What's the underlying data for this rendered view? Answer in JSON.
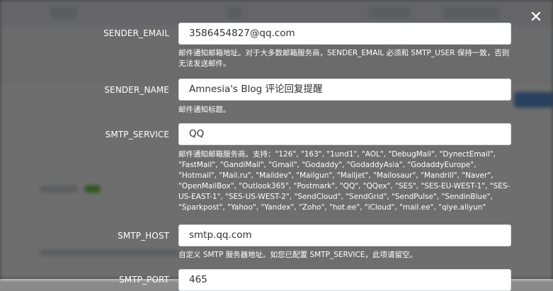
{
  "dialog": {
    "close_label": "✕"
  },
  "fields": [
    {
      "label": "SENDER_EMAIL",
      "value": "3586454827@qq.com",
      "help": "邮件通知邮箱地址。对于大多数邮箱服务商，SENDER_EMAIL 必须和 SMTP_USER 保持一致，否则无法发送邮件。"
    },
    {
      "label": "SENDER_NAME",
      "value": "Amnesia's Blog 评论回复提醒",
      "help": "邮件通知标题。"
    },
    {
      "label": "SMTP_SERVICE",
      "value": "QQ",
      "help": "邮件通知邮箱服务商。支持：\"126\", \"163\", \"1und1\", \"AOL\", \"DebugMail\", \"DynectEmail\", \"FastMail\", \"GandiMail\", \"Gmail\", \"Godaddy\", \"GodaddyAsia\", \"GodaddyEurope\", \"Hotmail\", \"Mail.ru\", \"Maildev\", \"Mailgun\", \"Mailjet\", \"Mailosaur\", \"Mandrill\", \"Naver\", \"OpenMailBox\", \"Outlook365\", \"Postmark\", \"QQ\", \"QQex\", \"SES\", \"SES-EU-WEST-1\", \"SES-US-EAST-1\", \"SES-US-WEST-2\", \"SendCloud\", \"SendGrid\", \"SendPulse\", \"SendinBlue\", \"Sparkpost\", \"Yahoo\", \"Yandex\", \"Zoho\", \"hot.ee\", \"iCloud\", \"mail.ee\", \"qiye.aliyun\""
    },
    {
      "label": "SMTP_HOST",
      "value": "smtp.qq.com",
      "help": "自定义 SMTP 服务器地址。如您已配置 SMTP_SERVICE，此项请留空。"
    },
    {
      "label": "SMTP_PORT",
      "value": "465",
      "help": ""
    }
  ]
}
